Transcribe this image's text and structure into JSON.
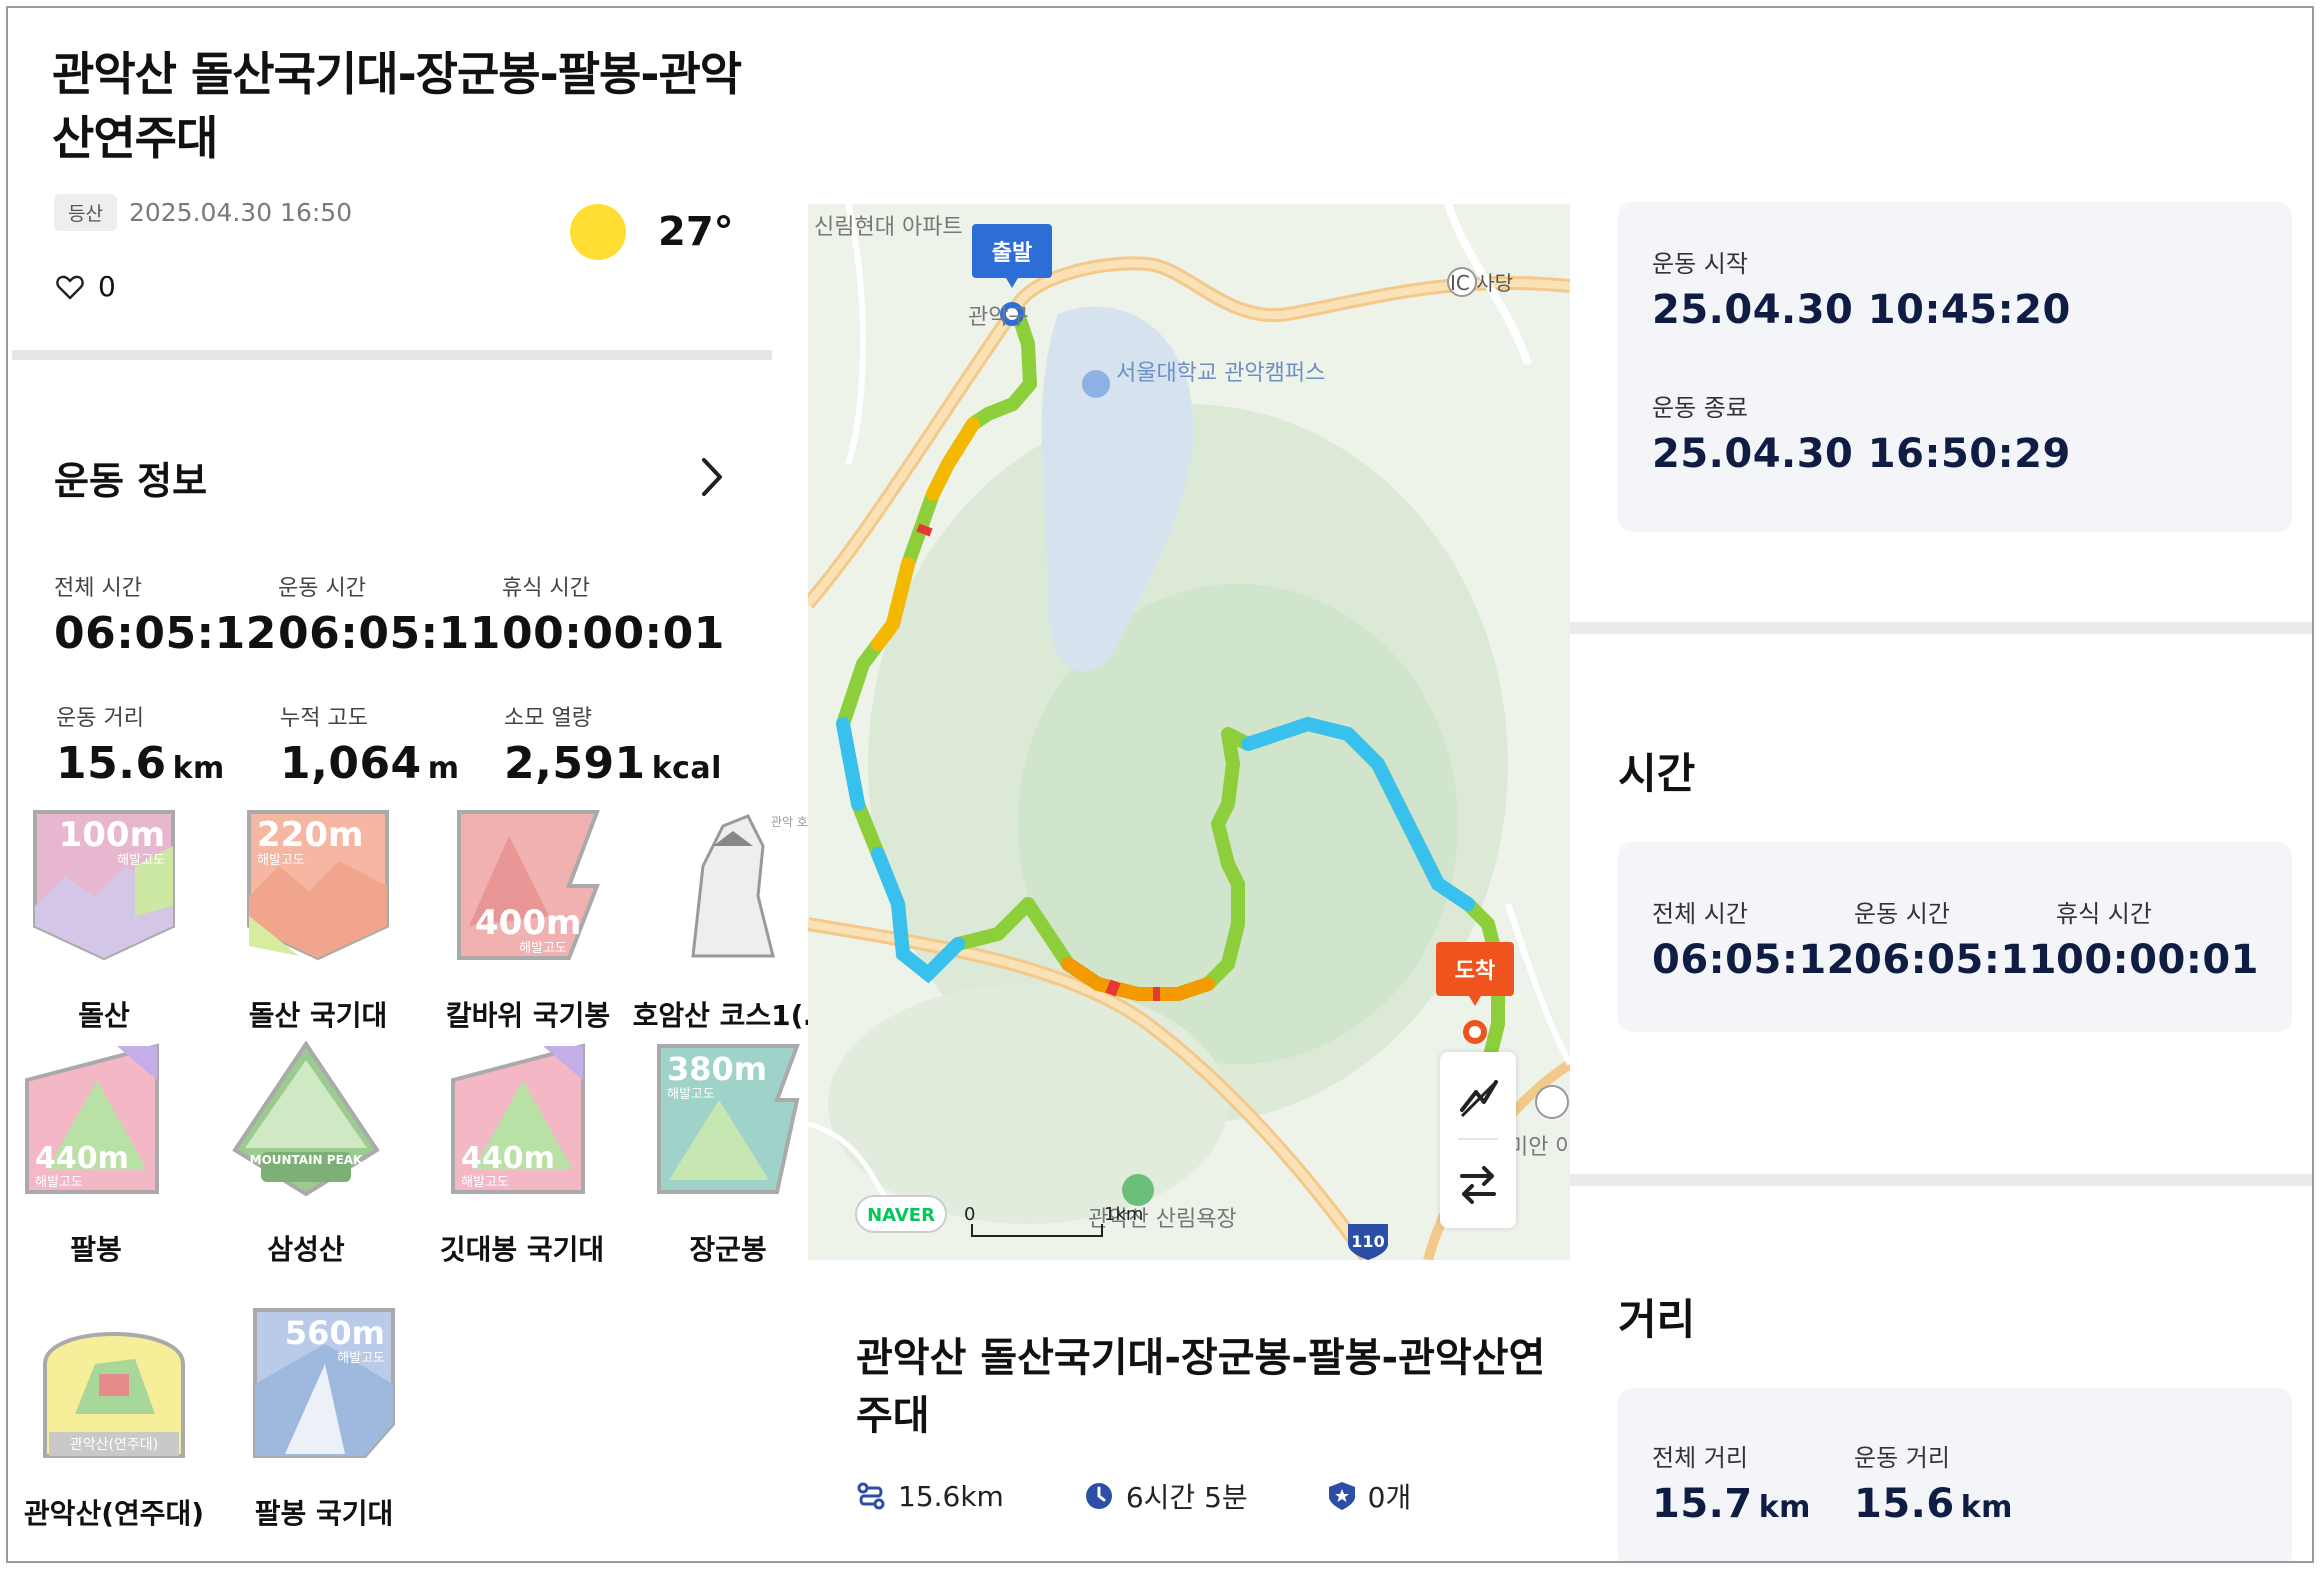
{
  "record": {
    "title": "관악산 돌산국기대-장군봉-팔봉-관악산연주대",
    "tag": "등산",
    "datetime": "2025.04.30 16:50",
    "temperature": "27°",
    "likes": "0"
  },
  "exercise_info": {
    "title": "운동 정보",
    "stats": [
      {
        "label": "전체 시간",
        "value": "06:05:12",
        "unit": ""
      },
      {
        "label": "운동 시간",
        "value": "06:05:11",
        "unit": ""
      },
      {
        "label": "휴식 시간",
        "value": "00:00:01",
        "unit": ""
      },
      {
        "label": "운동 거리",
        "value": "15.6",
        "unit": "km"
      },
      {
        "label": "누적 고도",
        "value": "1,064",
        "unit": "m"
      },
      {
        "label": "소모 열량",
        "value": "2,591",
        "unit": "kcal"
      }
    ]
  },
  "badges": [
    {
      "name": "돌산",
      "altitude": "100m",
      "alt_label": "해발고도",
      "color": "#e9a8c8"
    },
    {
      "name": "돌산 국기대",
      "altitude": "220m",
      "alt_label": "해발고도",
      "color": "#f2b09a"
    },
    {
      "name": "칼바위 국기봉",
      "altitude": "400m",
      "alt_label": "해발고도",
      "color": "#f3a6a6"
    },
    {
      "name": "호암산 코스1(…",
      "altitude": "",
      "alt_label": "관악 호암산 코스",
      "color": "#cccccc"
    },
    {
      "name": "팔봉",
      "altitude": "440m",
      "alt_label": "해발고도",
      "color": "#a7d9a0"
    },
    {
      "name": "삼성산",
      "altitude": "",
      "alt_label": "MOUNTAIN PEAK",
      "color": "#8fbf86"
    },
    {
      "name": "깃대봉 국기대",
      "altitude": "440m",
      "alt_label": "해발고도",
      "color": "#a7d9a0"
    },
    {
      "name": "장군봉",
      "altitude": "380m",
      "alt_label": "해발고도",
      "color": "#9ad1c8"
    },
    {
      "name": "관악산(연주대)",
      "altitude": "",
      "alt_label": "관악산(연주대)",
      "color": "#f5e98a"
    },
    {
      "name": "팔봉 국기대",
      "altitude": "560m",
      "alt_label": "해발고도",
      "color": "#b3c8e8"
    }
  ],
  "map": {
    "start_label": "출발",
    "end_label": "도착",
    "place_labels": [
      "신림현대 아파트",
      "관악구",
      "서울대학교 관악캠퍼스",
      "IC 사당",
      "관악산 산림욕장",
      "미안 아파트"
    ],
    "route_number": "110",
    "provider": "NAVER",
    "scale_zero": "0",
    "scale_km": "1km"
  },
  "route": {
    "title": "관악산 돌산국기대-장군봉-팔봉-관악산연주대",
    "distance": "15.6km",
    "duration": "6시간 5분",
    "badge_count": "0개"
  },
  "right_panel": {
    "start_label": "운동 시작",
    "start_value": "25.04.30 10:45:20",
    "end_label": "운동 종료",
    "end_value": "25.04.30 16:50:29",
    "time_title": "시간",
    "time_stats": [
      {
        "label": "전체 시간",
        "value": "06:05:12"
      },
      {
        "label": "운동 시간",
        "value": "06:05:11"
      },
      {
        "label": "휴식 시간",
        "value": "00:00:01"
      }
    ],
    "distance_title": "거리",
    "distance_stats": [
      {
        "label": "전체 거리",
        "value": "15.7",
        "unit": "km"
      },
      {
        "label": "운동 거리",
        "value": "15.6",
        "unit": "km"
      }
    ]
  }
}
